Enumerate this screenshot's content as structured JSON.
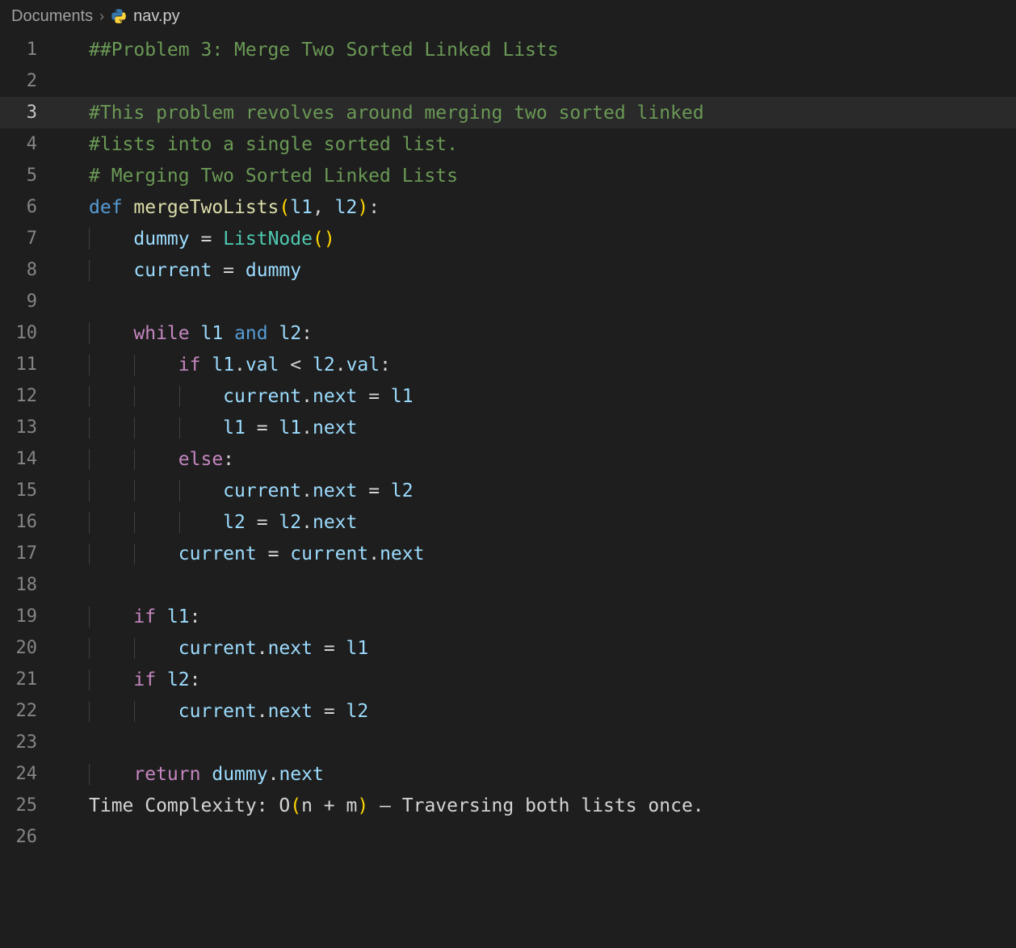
{
  "breadcrumb": {
    "folder": "Documents",
    "separator": "›",
    "file": "nav.py"
  },
  "current_line": 3,
  "lines": [
    {
      "n": 1,
      "guides": [],
      "tokens": [
        [
          "comment",
          "##Problem 3: Merge Two Sorted Linked Lists"
        ]
      ]
    },
    {
      "n": 2,
      "guides": [],
      "tokens": []
    },
    {
      "n": 3,
      "guides": [],
      "tokens": [
        [
          "comment",
          "#This problem revolves around merging two sorted linked"
        ]
      ]
    },
    {
      "n": 4,
      "guides": [],
      "tokens": [
        [
          "comment",
          "#lists into a single sorted list."
        ]
      ]
    },
    {
      "n": 5,
      "guides": [],
      "tokens": [
        [
          "comment",
          "# Merging Two Sorted Linked Lists"
        ]
      ]
    },
    {
      "n": 6,
      "guides": [],
      "tokens": [
        [
          "keyword",
          "def "
        ],
        [
          "func",
          "mergeTwoLists"
        ],
        [
          "paren-y",
          "("
        ],
        [
          "param",
          "l1"
        ],
        [
          "default",
          ", "
        ],
        [
          "param",
          "l2"
        ],
        [
          "paren-y",
          ")"
        ],
        [
          "default",
          ":"
        ]
      ]
    },
    {
      "n": 7,
      "guides": [
        1
      ],
      "tokens": [
        [
          "default",
          "    "
        ],
        [
          "var",
          "dummy"
        ],
        [
          "default",
          " = "
        ],
        [
          "class",
          "ListNode"
        ],
        [
          "paren-y",
          "()"
        ]
      ]
    },
    {
      "n": 8,
      "guides": [
        1
      ],
      "tokens": [
        [
          "default",
          "    "
        ],
        [
          "var",
          "current"
        ],
        [
          "default",
          " = "
        ],
        [
          "var",
          "dummy"
        ]
      ]
    },
    {
      "n": 9,
      "guides": [
        1
      ],
      "tokens": []
    },
    {
      "n": 10,
      "guides": [
        1
      ],
      "tokens": [
        [
          "default",
          "    "
        ],
        [
          "control",
          "while"
        ],
        [
          "default",
          " "
        ],
        [
          "var",
          "l1"
        ],
        [
          "default",
          " "
        ],
        [
          "keyword",
          "and"
        ],
        [
          "default",
          " "
        ],
        [
          "var",
          "l2"
        ],
        [
          "default",
          ":"
        ]
      ]
    },
    {
      "n": 11,
      "guides": [
        1,
        2
      ],
      "tokens": [
        [
          "default",
          "        "
        ],
        [
          "control",
          "if"
        ],
        [
          "default",
          " "
        ],
        [
          "var",
          "l1"
        ],
        [
          "default",
          "."
        ],
        [
          "var",
          "val"
        ],
        [
          "default",
          " < "
        ],
        [
          "var",
          "l2"
        ],
        [
          "default",
          "."
        ],
        [
          "var",
          "val"
        ],
        [
          "default",
          ":"
        ]
      ]
    },
    {
      "n": 12,
      "guides": [
        1,
        2,
        3
      ],
      "tokens": [
        [
          "default",
          "            "
        ],
        [
          "var",
          "current"
        ],
        [
          "default",
          "."
        ],
        [
          "var",
          "next"
        ],
        [
          "default",
          " = "
        ],
        [
          "var",
          "l1"
        ]
      ]
    },
    {
      "n": 13,
      "guides": [
        1,
        2,
        3
      ],
      "tokens": [
        [
          "default",
          "            "
        ],
        [
          "var",
          "l1"
        ],
        [
          "default",
          " = "
        ],
        [
          "var",
          "l1"
        ],
        [
          "default",
          "."
        ],
        [
          "var",
          "next"
        ]
      ]
    },
    {
      "n": 14,
      "guides": [
        1,
        2
      ],
      "tokens": [
        [
          "default",
          "        "
        ],
        [
          "control",
          "else"
        ],
        [
          "default",
          ":"
        ]
      ]
    },
    {
      "n": 15,
      "guides": [
        1,
        2,
        3
      ],
      "tokens": [
        [
          "default",
          "            "
        ],
        [
          "var",
          "current"
        ],
        [
          "default",
          "."
        ],
        [
          "var",
          "next"
        ],
        [
          "default",
          " = "
        ],
        [
          "var",
          "l2"
        ]
      ]
    },
    {
      "n": 16,
      "guides": [
        1,
        2,
        3
      ],
      "tokens": [
        [
          "default",
          "            "
        ],
        [
          "var",
          "l2"
        ],
        [
          "default",
          " = "
        ],
        [
          "var",
          "l2"
        ],
        [
          "default",
          "."
        ],
        [
          "var",
          "next"
        ]
      ]
    },
    {
      "n": 17,
      "guides": [
        1,
        2
      ],
      "tokens": [
        [
          "default",
          "        "
        ],
        [
          "var",
          "current"
        ],
        [
          "default",
          " = "
        ],
        [
          "var",
          "current"
        ],
        [
          "default",
          "."
        ],
        [
          "var",
          "next"
        ]
      ]
    },
    {
      "n": 18,
      "guides": [
        1
      ],
      "tokens": []
    },
    {
      "n": 19,
      "guides": [
        1
      ],
      "tokens": [
        [
          "default",
          "    "
        ],
        [
          "control",
          "if"
        ],
        [
          "default",
          " "
        ],
        [
          "var",
          "l1"
        ],
        [
          "default",
          ":"
        ]
      ]
    },
    {
      "n": 20,
      "guides": [
        1,
        2
      ],
      "tokens": [
        [
          "default",
          "        "
        ],
        [
          "var",
          "current"
        ],
        [
          "default",
          "."
        ],
        [
          "var",
          "next"
        ],
        [
          "default",
          " = "
        ],
        [
          "var",
          "l1"
        ]
      ]
    },
    {
      "n": 21,
      "guides": [
        1
      ],
      "tokens": [
        [
          "default",
          "    "
        ],
        [
          "control",
          "if"
        ],
        [
          "default",
          " "
        ],
        [
          "var",
          "l2"
        ],
        [
          "default",
          ":"
        ]
      ]
    },
    {
      "n": 22,
      "guides": [
        1,
        2
      ],
      "tokens": [
        [
          "default",
          "        "
        ],
        [
          "var",
          "current"
        ],
        [
          "default",
          "."
        ],
        [
          "var",
          "next"
        ],
        [
          "default",
          " = "
        ],
        [
          "var",
          "l2"
        ]
      ]
    },
    {
      "n": 23,
      "guides": [
        1
      ],
      "tokens": []
    },
    {
      "n": 24,
      "guides": [
        1
      ],
      "tokens": [
        [
          "default",
          "    "
        ],
        [
          "control",
          "return"
        ],
        [
          "default",
          " "
        ],
        [
          "var",
          "dummy"
        ],
        [
          "default",
          "."
        ],
        [
          "var",
          "next"
        ]
      ]
    },
    {
      "n": 25,
      "guides": [],
      "tokens": [
        [
          "default",
          "Time Complexity: O"
        ],
        [
          "paren-y",
          "("
        ],
        [
          "default",
          "n + m"
        ],
        [
          "paren-y",
          ")"
        ],
        [
          "default",
          " – Traversing both lists once."
        ]
      ]
    },
    {
      "n": 26,
      "guides": [],
      "tokens": []
    }
  ]
}
